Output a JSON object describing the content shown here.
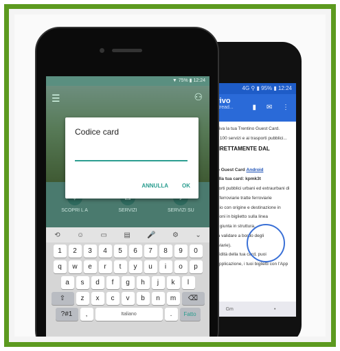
{
  "back_phone": {
    "status": "4G ⚲ ▮ 95% ▮ 12:24",
    "header_title": "arrivo",
    "header_sub": "...@tread...",
    "body": [
      "Ti arriva la tua Trentino Guest Card.",
      "Oltre 100 servizi e ai trasporti pubblici...",
      "D DIRETTAMENTE DAL",
      "NE!",
      "ntino Guest Card",
      "Android",
      "la della tua card:",
      "kpmk3t",
      "trasporti pubblici urbani ed extraurbani di",
      "linee ferroviarie tratte ferroviarie",
      "viaggio con origine e destinazione in",
      "riduzioni in biglietto sulla linea",
      "Valle giunta in struttura.",
      "le (da validare a bordo degli",
      "ferroviarie).",
      "di validità della tua card, puoi",
      "dall'applicazione, i tuoi biglietti con l'App"
    ],
    "bottom": [
      "Gm",
      "•"
    ]
  },
  "front_phone": {
    "status": "▼ 75% ▮ 12:24",
    "menu_icon": "hamburger-icon",
    "user_icon": "user-icon",
    "tiles": [
      {
        "label": "SCOPRI L A",
        "icon": "compass-icon"
      },
      {
        "label": "SERVIZI",
        "icon": "gift-icon"
      },
      {
        "label": "SERVIZI SU",
        "icon": "bell-icon"
      }
    ],
    "dialog": {
      "title": "Codice card",
      "input_value": "",
      "cancel": "ANNULLA",
      "ok": "OK"
    },
    "toolbar": [
      "⟲",
      "☺",
      "▭",
      "▤",
      "🎤",
      "⚙",
      "⌄"
    ],
    "keyboard": {
      "row1": [
        "1",
        "2",
        "3",
        "4",
        "5",
        "6",
        "7",
        "8",
        "9",
        "0"
      ],
      "row2": [
        "q",
        "w",
        "e",
        "r",
        "t",
        "y",
        "u",
        "i",
        "o",
        "p"
      ],
      "row3": [
        "a",
        "s",
        "d",
        "f",
        "g",
        "h",
        "j",
        "k",
        "l"
      ],
      "row4": [
        "⇧",
        "z",
        "x",
        "c",
        "v",
        "b",
        "n",
        "m",
        "⌫"
      ],
      "row5": [
        "?#1",
        ",",
        "Italiano",
        ".",
        "Fatto"
      ]
    }
  }
}
